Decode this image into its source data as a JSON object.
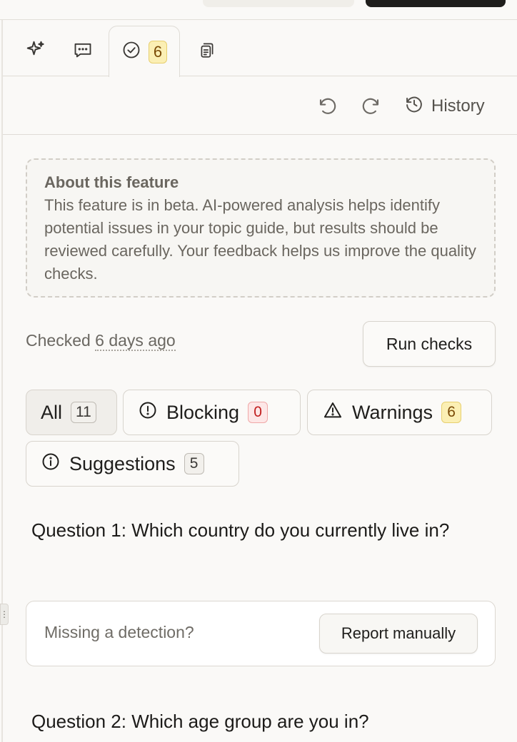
{
  "tabs": [
    {
      "name": "ai-assistant",
      "icon": "sparkle-icon"
    },
    {
      "name": "comments",
      "icon": "comment-icon"
    },
    {
      "name": "quality-checks",
      "icon": "check-circle-icon",
      "badge": "6",
      "active": true
    },
    {
      "name": "documents",
      "icon": "document-icon"
    }
  ],
  "toolbar": {
    "undo_icon": "undo-icon",
    "redo_icon": "redo-icon",
    "history_label": "History"
  },
  "info": {
    "title": "About this feature",
    "text": "This feature is in beta. AI-powered analysis helps identify potential issues in your topic guide, but results should be reviewed carefully. Your feedback helps us improve the quality checks."
  },
  "status": {
    "checked_prefix": "Checked",
    "checked_time": "6 days ago",
    "run_label": "Run checks"
  },
  "filters": [
    {
      "label": "All",
      "count": "11",
      "active": true
    },
    {
      "label": "Blocking",
      "count": "0",
      "icon": "alert-circle-icon"
    },
    {
      "label": "Warnings",
      "count": "6",
      "icon": "warning-triangle-icon"
    },
    {
      "label": "Suggestions",
      "count": "5",
      "icon": "info-circle-icon"
    }
  ],
  "questions": [
    {
      "title": "Question 1: Which country do you currently live in?"
    },
    {
      "title": "Question 2: Which age group are you in?"
    }
  ],
  "report": {
    "label": "Missing a detection?",
    "button_label": "Report manually"
  },
  "colors": {
    "background": "#faf9f7",
    "warning_badge": "#fbefb4",
    "blocking_badge": "#fde7e7"
  }
}
